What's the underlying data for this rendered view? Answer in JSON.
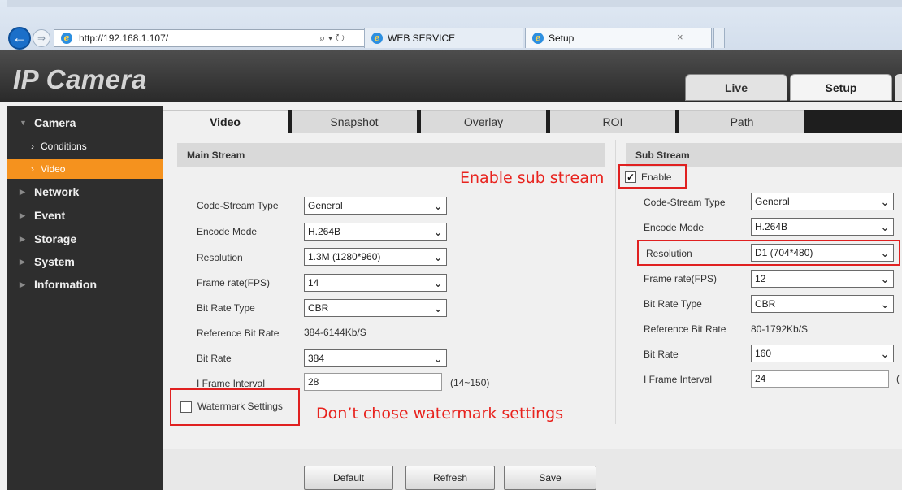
{
  "browser": {
    "url": "http://192.168.1.107/",
    "url_controls": "⌕ ▾ ↻",
    "tabs": [
      {
        "label": "WEB SERVICE"
      },
      {
        "label": "Setup",
        "close": "×"
      }
    ]
  },
  "app": {
    "logo": "IP Camera",
    "top_tabs": [
      "Live",
      "Setup"
    ]
  },
  "sidebar": {
    "sections": [
      {
        "label": "Camera",
        "expanded": true
      },
      {
        "label": "Network"
      },
      {
        "label": "Event"
      },
      {
        "label": "Storage"
      },
      {
        "label": "System"
      },
      {
        "label": "Information"
      }
    ],
    "camera_items": [
      {
        "label": "Conditions"
      },
      {
        "label": "Video",
        "selected": true
      }
    ]
  },
  "content": {
    "tabs": [
      "Video",
      "Snapshot",
      "Overlay",
      "ROI",
      "Path"
    ],
    "main_stream": {
      "title": "Main Stream",
      "fields": {
        "code_stream_type": {
          "label": "Code-Stream Type",
          "value": "General"
        },
        "encode_mode": {
          "label": "Encode Mode",
          "value": "H.264B"
        },
        "resolution": {
          "label": "Resolution",
          "value": "1.3M (1280*960)"
        },
        "frame_rate": {
          "label": "Frame rate(FPS)",
          "value": "14"
        },
        "bit_rate_type": {
          "label": "Bit Rate Type",
          "value": "CBR"
        },
        "reference_bit_rate": {
          "label": "Reference Bit Rate",
          "value": "384-6144Kb/S"
        },
        "bit_rate": {
          "label": "Bit Rate",
          "value": "384"
        },
        "i_frame_interval": {
          "label": "I Frame Interval",
          "value": "28",
          "range": "(14~150)"
        }
      },
      "watermark": {
        "label": "Watermark Settings",
        "checked": false
      }
    },
    "sub_stream": {
      "title": "Sub Stream",
      "enable": {
        "label": "Enable",
        "checked": true
      },
      "fields": {
        "code_stream_type": {
          "label": "Code-Stream Type",
          "value": "General"
        },
        "encode_mode": {
          "label": "Encode Mode",
          "value": "H.264B"
        },
        "resolution": {
          "label": "Resolution",
          "value": "D1 (704*480)"
        },
        "frame_rate": {
          "label": "Frame rate(FPS)",
          "value": "12"
        },
        "bit_rate_type": {
          "label": "Bit Rate Type",
          "value": "CBR"
        },
        "reference_bit_rate": {
          "label": "Reference Bit Rate",
          "value": "80-1792Kb/S"
        },
        "bit_rate": {
          "label": "Bit Rate",
          "value": "160"
        },
        "i_frame_interval": {
          "label": "I Frame Interval",
          "value": "24",
          "range": "("
        }
      }
    },
    "buttons": {
      "default": "Default",
      "refresh": "Refresh",
      "save": "Save"
    }
  },
  "annotations": {
    "enable_sub": "Enable sub stream",
    "watermark": "Don’t chose watermark settings"
  },
  "colors": {
    "accent": "#f5921e",
    "annotation": "#e02020",
    "sidebar_bg": "#2e2e2e",
    "header_bg": "#3a3a3a"
  },
  "icons": {
    "back": "back-arrow-icon",
    "forward": "forward-arrow-icon",
    "browser": "ie-logo-icon",
    "dropdown": "chevron-down-icon",
    "collapsed": "triangle-right-icon",
    "expanded": "triangle-down-icon"
  }
}
